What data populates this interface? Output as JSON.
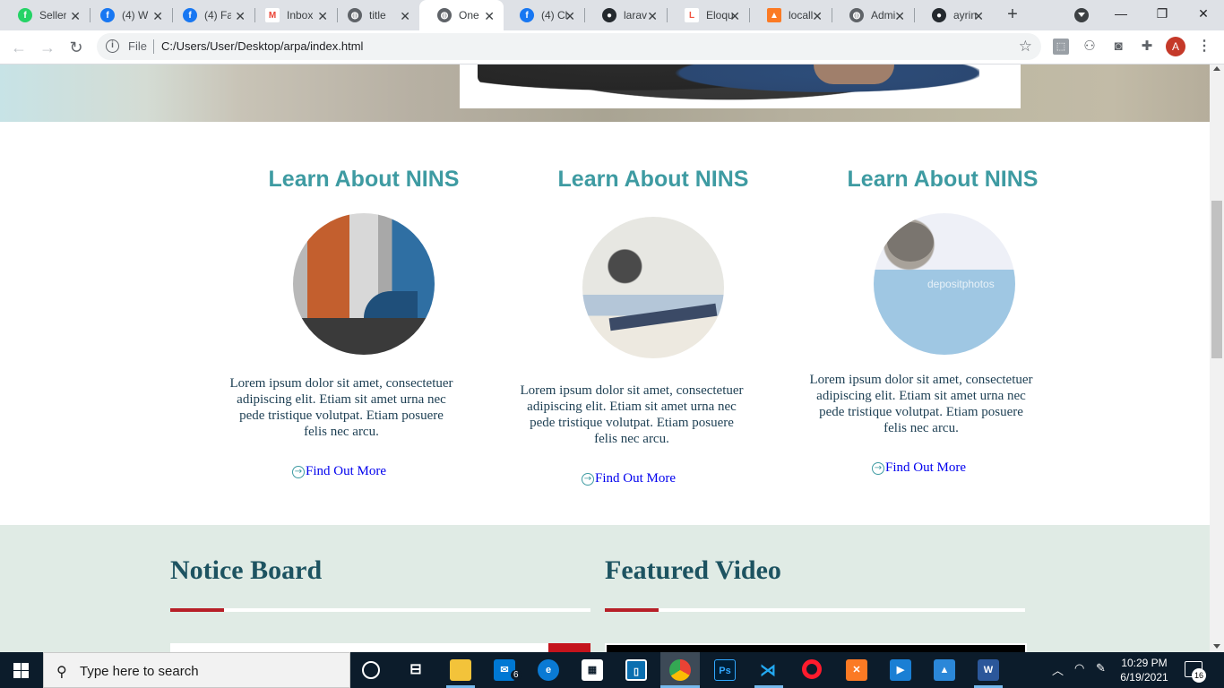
{
  "browser": {
    "tabs": [
      {
        "title": "Seller",
        "icon": "seller-icon",
        "color": "#25d366"
      },
      {
        "title": "(4) W",
        "icon": "facebook-icon",
        "color": "#1877f2"
      },
      {
        "title": "(4) Fa",
        "icon": "facebook-icon",
        "color": "#1877f2"
      },
      {
        "title": "Inbox",
        "icon": "gmail-icon",
        "color": "#ea4335"
      },
      {
        "title": "title",
        "icon": "globe-icon",
        "color": "#5f6368"
      },
      {
        "title": "One",
        "icon": "globe-icon",
        "color": "#5f6368",
        "active": true
      },
      {
        "title": "(4) Cl",
        "icon": "facebook-icon",
        "color": "#1877f2"
      },
      {
        "title": "larav",
        "icon": "github-icon",
        "color": "#24292e"
      },
      {
        "title": "Eloqu",
        "icon": "laravel-icon",
        "color": "#f05340"
      },
      {
        "title": "locall",
        "icon": "xampp-icon",
        "color": "#fb7a24"
      },
      {
        "title": "Admi",
        "icon": "globe-icon",
        "color": "#5f6368"
      },
      {
        "title": "ayrin",
        "icon": "github-icon",
        "color": "#24292e"
      }
    ],
    "address": {
      "scheme_label": "File",
      "url": "C:/Users/User/Desktop/arpa/index.html"
    },
    "profile_initial": "A"
  },
  "cards": [
    {
      "title": "Learn About NINS",
      "image": "hospital-building",
      "text": "Lorem ipsum dolor sit amet, consectetuer adipiscing elit. Etiam sit amet urna nec pede tristique volutpat. Etiam posuere felis nec arcu.",
      "link": "Find Out More"
    },
    {
      "title": "Learn About NINS",
      "image": "scanner-room",
      "text": "Lorem ipsum dolor sit amet, consectetuer adipiscing elit. Etiam sit amet urna nec pede tristique volutpat. Etiam posuere felis nec arcu.",
      "link": "Find Out More"
    },
    {
      "title": "Learn About NINS",
      "image": "operating-theatre",
      "watermark": "depositphotos",
      "text": "Lorem ipsum dolor sit amet, consectetuer adipiscing elit. Etiam sit amet urna nec pede tristique volutpat. Etiam posuere felis nec arcu.",
      "link": "Find Out More"
    }
  ],
  "band": {
    "notice_title": "Notice Board",
    "video_title": "Featured Video"
  },
  "colors": {
    "heading_teal": "#3e9ba2",
    "band_bg": "#e0ebe5",
    "accent_red": "#b71f27",
    "band_title": "#1d5361"
  },
  "taskbar": {
    "search_placeholder": "Type here to search",
    "mail_badge": "6",
    "time": "10:29 PM",
    "date": "6/19/2021",
    "notifications": "16",
    "apps": [
      "cortana",
      "task-view",
      "file-explorer",
      "mail",
      "edge",
      "store",
      "app",
      "chrome",
      "photoshop",
      "vscode",
      "opera",
      "xampp",
      "media",
      "photos",
      "word"
    ]
  }
}
